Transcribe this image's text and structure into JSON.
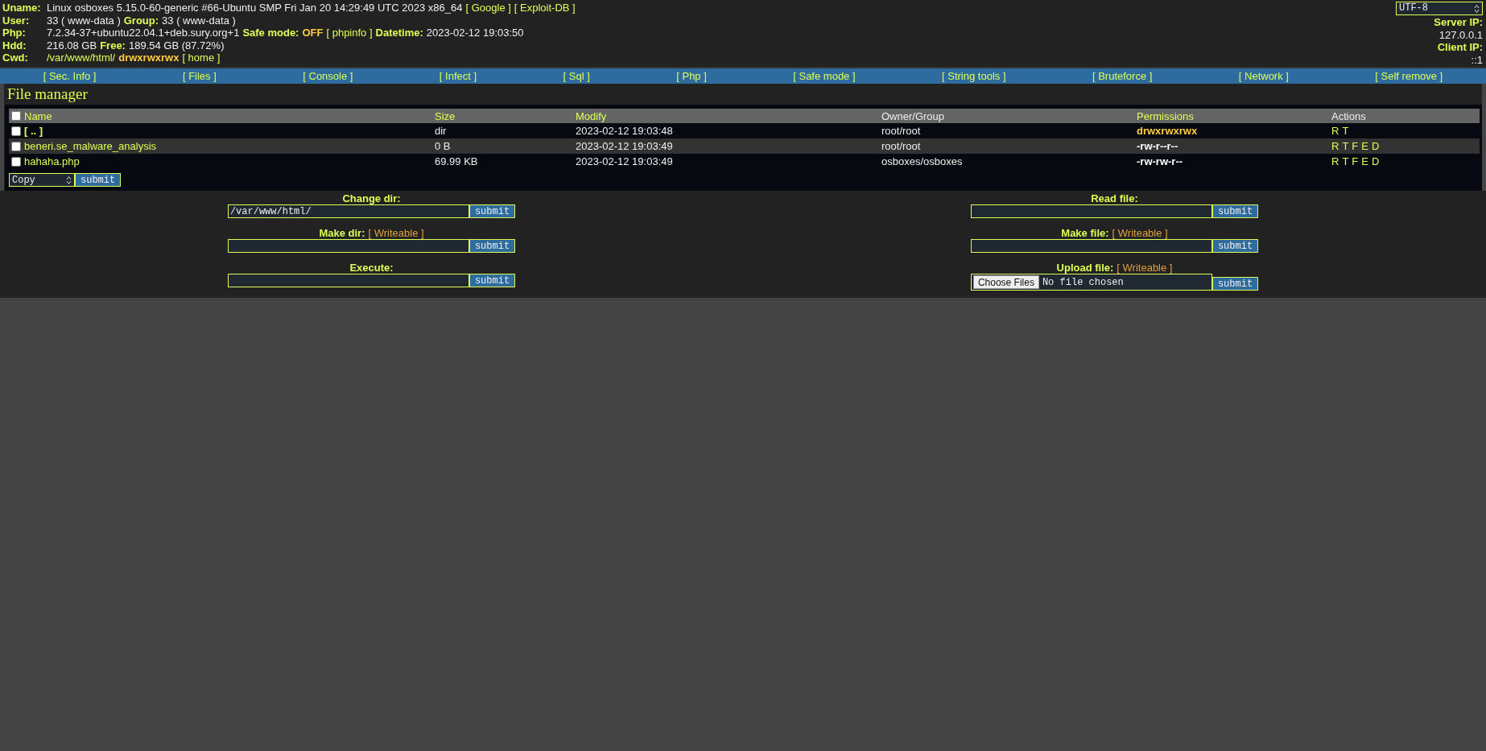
{
  "header": {
    "rows": [
      {
        "label": "Uname:",
        "segments": [
          {
            "kind": "value",
            "text": "Linux osboxes 5.15.0-60-generic #66-Ubuntu SMP Fri Jan 20 14:29:49 UTC 2023 x86_64"
          },
          {
            "kind": "link",
            "text": "[ Google ]"
          },
          {
            "kind": "link",
            "text": "[ Exploit-DB ]"
          }
        ]
      },
      {
        "label": "User:",
        "segments": [
          {
            "kind": "value",
            "text": "33 ( www-data )"
          },
          {
            "kind": "label",
            "text": "Group:"
          },
          {
            "kind": "value",
            "text": "33 ( www-data )"
          }
        ]
      },
      {
        "label": "Php:",
        "segments": [
          {
            "kind": "value",
            "text": "7.2.34-37+ubuntu22.04.1+deb.sury.org+1"
          },
          {
            "kind": "label",
            "text": "Safe mode:"
          },
          {
            "kind": "status",
            "text": "OFF"
          },
          {
            "kind": "link",
            "text": "[ phpinfo ]"
          },
          {
            "kind": "label",
            "text": "Datetime:"
          },
          {
            "kind": "value",
            "text": "2023-02-12 19:03:50"
          }
        ]
      },
      {
        "label": "Hdd:",
        "segments": [
          {
            "kind": "value",
            "text": "216.08 GB"
          },
          {
            "kind": "label",
            "text": "Free:"
          },
          {
            "kind": "value",
            "text": "189.54 GB (87.72%)"
          }
        ]
      },
      {
        "label": "Cwd:",
        "segments": [
          {
            "kind": "link",
            "text": "/var/www/html/"
          },
          {
            "kind": "status",
            "text": "drwxrwxrwx"
          },
          {
            "kind": "link",
            "text": "[ home ]"
          }
        ]
      }
    ],
    "charset": "UTF-8",
    "server_ip_label": "Server IP:",
    "server_ip": "127.0.0.1",
    "client_ip_label": "Client IP:",
    "client_ip": "::1"
  },
  "nav": [
    "[ Sec. Info ]",
    "[ Files ]",
    "[ Console ]",
    "[ Infect ]",
    "[ Sql ]",
    "[ Php ]",
    "[ Safe mode ]",
    "[ String tools ]",
    "[ Bruteforce ]",
    "[ Network ]",
    "[ Self remove ]"
  ],
  "file_manager": {
    "title": "File manager",
    "select_all_checked": false,
    "columns": [
      {
        "label": "Name",
        "link": true
      },
      {
        "label": "Size",
        "link": true
      },
      {
        "label": "Modify",
        "link": true
      },
      {
        "label": "Owner/Group",
        "link": false
      },
      {
        "label": "Permissions",
        "link": true
      },
      {
        "label": "Actions",
        "link": false
      }
    ],
    "rows": [
      {
        "checked": false,
        "kind": "dir",
        "name": "[ .. ]",
        "size": "dir",
        "modify": "2023-02-12 19:03:48",
        "owner": "root/root",
        "permissions": "drwxrwxrwx",
        "writable": true,
        "actions": [
          "R",
          "T"
        ]
      },
      {
        "checked": false,
        "kind": "file",
        "name": "beneri.se_malware_analysis",
        "size": "0 B",
        "modify": "2023-02-12 19:03:49",
        "owner": "root/root",
        "permissions": "-rw-r--r--",
        "writable": false,
        "actions": [
          "R",
          "T",
          "F",
          "E",
          "D"
        ]
      },
      {
        "checked": false,
        "kind": "file",
        "name": "hahaha.php",
        "size": "69.99 KB",
        "modify": "2023-02-12 19:03:49",
        "owner": "osboxes/osboxes",
        "permissions": "-rw-rw-r--",
        "writable": false,
        "actions": [
          "R",
          "T",
          "F",
          "E",
          "D"
        ]
      }
    ],
    "bulk_action": "Copy",
    "bulk_submit": "submit"
  },
  "forms": [
    {
      "items": [
        {
          "kind": "text",
          "label": "Change dir:",
          "field": {
            "value": "/var/www/html/"
          },
          "submit": "submit"
        },
        {
          "kind": "text",
          "label": "Make dir:",
          "note": "[ Writeable ]",
          "submit": "submit"
        },
        {
          "kind": "text",
          "label": "Execute:",
          "submit": "submit"
        }
      ]
    },
    {
      "items": [
        {
          "kind": "text",
          "label": "Read file:",
          "submit": "submit"
        },
        {
          "kind": "text",
          "label": "Make file:",
          "note": "[ Writeable ]",
          "submit": "submit"
        },
        {
          "kind": "file",
          "label": "Upload file:",
          "note": "[ Writeable ]",
          "choose": "Choose Files",
          "status": "No file chosen",
          "submit": "submit"
        }
      ]
    }
  ]
}
